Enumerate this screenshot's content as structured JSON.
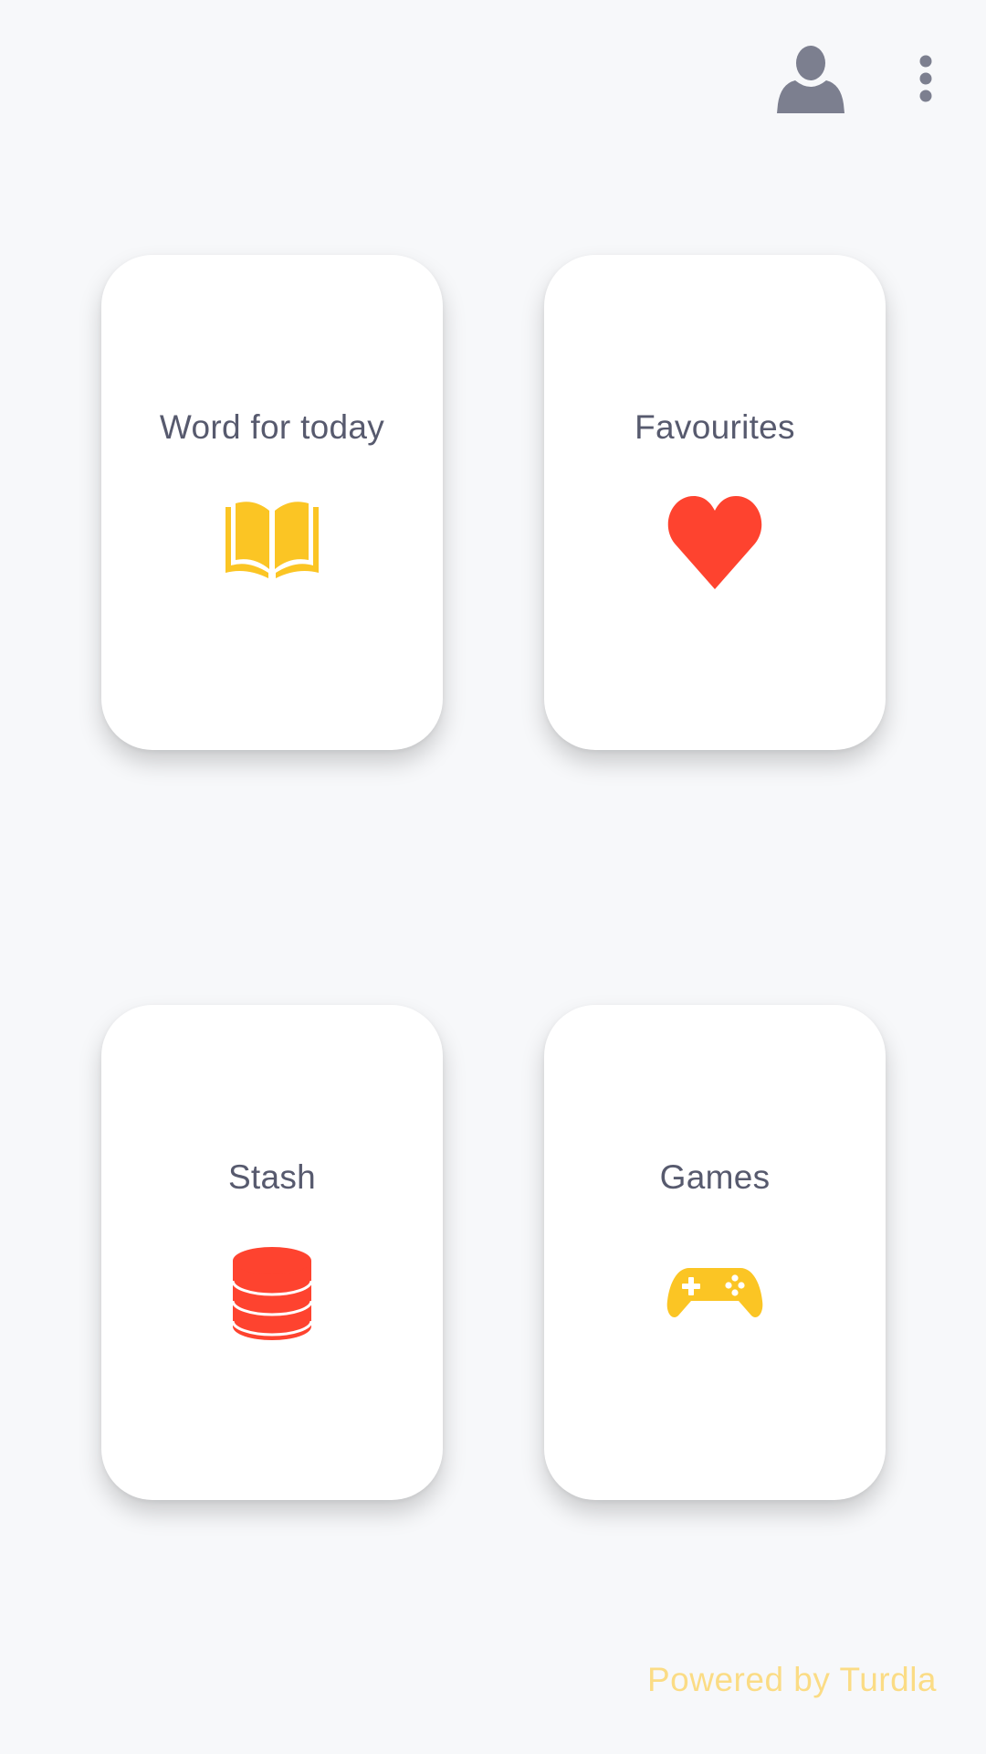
{
  "header": {
    "profile_icon": "user-icon",
    "menu_icon": "more-vertical-icon"
  },
  "cards": [
    {
      "title": "Word for today",
      "icon": "book-icon",
      "icon_color": "#fbc524"
    },
    {
      "title": "Favourites",
      "icon": "heart-icon",
      "icon_color": "#fe432f"
    },
    {
      "title": "Stash",
      "icon": "database-icon",
      "icon_color": "#fe432f"
    },
    {
      "title": "Games",
      "icon": "gamepad-icon",
      "icon_color": "#fbc524"
    }
  ],
  "footer": {
    "text": "Powered by Turdla"
  },
  "colors": {
    "background": "#f7f8fa",
    "card": "#ffffff",
    "title_text": "#575a6e",
    "header_icons": "#7c7f8f",
    "footer_text": "#fbdc85"
  }
}
